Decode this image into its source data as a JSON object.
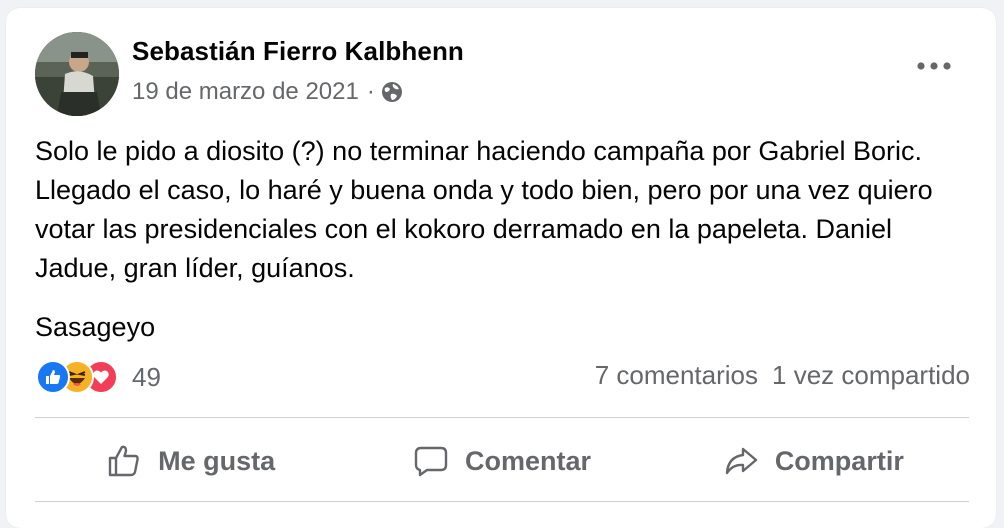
{
  "post": {
    "author": "Sebastián Fierro Kalbhenn",
    "date": "19 de marzo de 2021",
    "separator": "·",
    "privacy_icon": "globe-icon",
    "paragraphs": [
      "Solo le pido a diosito (?) no terminar haciendo campaña por Gabriel Boric. Llegado el caso, lo haré y buena onda y todo bien, pero por una vez quiero votar las presidenciales con el kokoro derramado en la papeleta. Daniel Jadue, gran líder, guíanos.",
      "Sasageyo"
    ]
  },
  "reactions": {
    "icons": [
      "like-reaction-icon",
      "haha-reaction-icon",
      "love-reaction-icon"
    ],
    "count": "49",
    "comments": "7 comentarios",
    "shares": "1 vez compartido"
  },
  "actions": {
    "like": "Me gusta",
    "comment": "Comentar",
    "share": "Compartir"
  },
  "colors": {
    "text": "#050505",
    "muted": "#65676b",
    "like_blue": "#1877f2",
    "haha_yellow": "#f7b125",
    "love_red": "#f33e58",
    "divider": "#ced0d4"
  }
}
